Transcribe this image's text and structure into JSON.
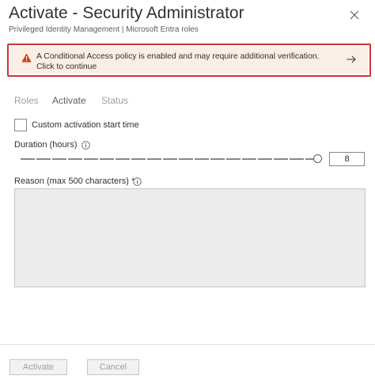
{
  "header": {
    "title": "Activate - Security Administrator",
    "subtitle": "Privileged Identity Management | Microsoft Entra roles"
  },
  "alert": {
    "text": "A Conditional Access policy is enabled and may require additional verification. Click to continue",
    "icon": "warning-icon",
    "border_color": "#d13438",
    "background": "#fbeee5"
  },
  "tabs": [
    {
      "label": "Roles",
      "selected": false
    },
    {
      "label": "Activate",
      "selected": true
    },
    {
      "label": "Status",
      "selected": false
    }
  ],
  "form": {
    "custom_start_label": "Custom activation start time",
    "custom_start_checked": false,
    "duration_label": "Duration (hours)",
    "duration_value": "8",
    "duration_max": 8,
    "reason_label": "Reason (max 500 characters)",
    "required_marker": "*",
    "reason_value": ""
  },
  "footer": {
    "activate_label": "Activate",
    "cancel_label": "Cancel"
  }
}
